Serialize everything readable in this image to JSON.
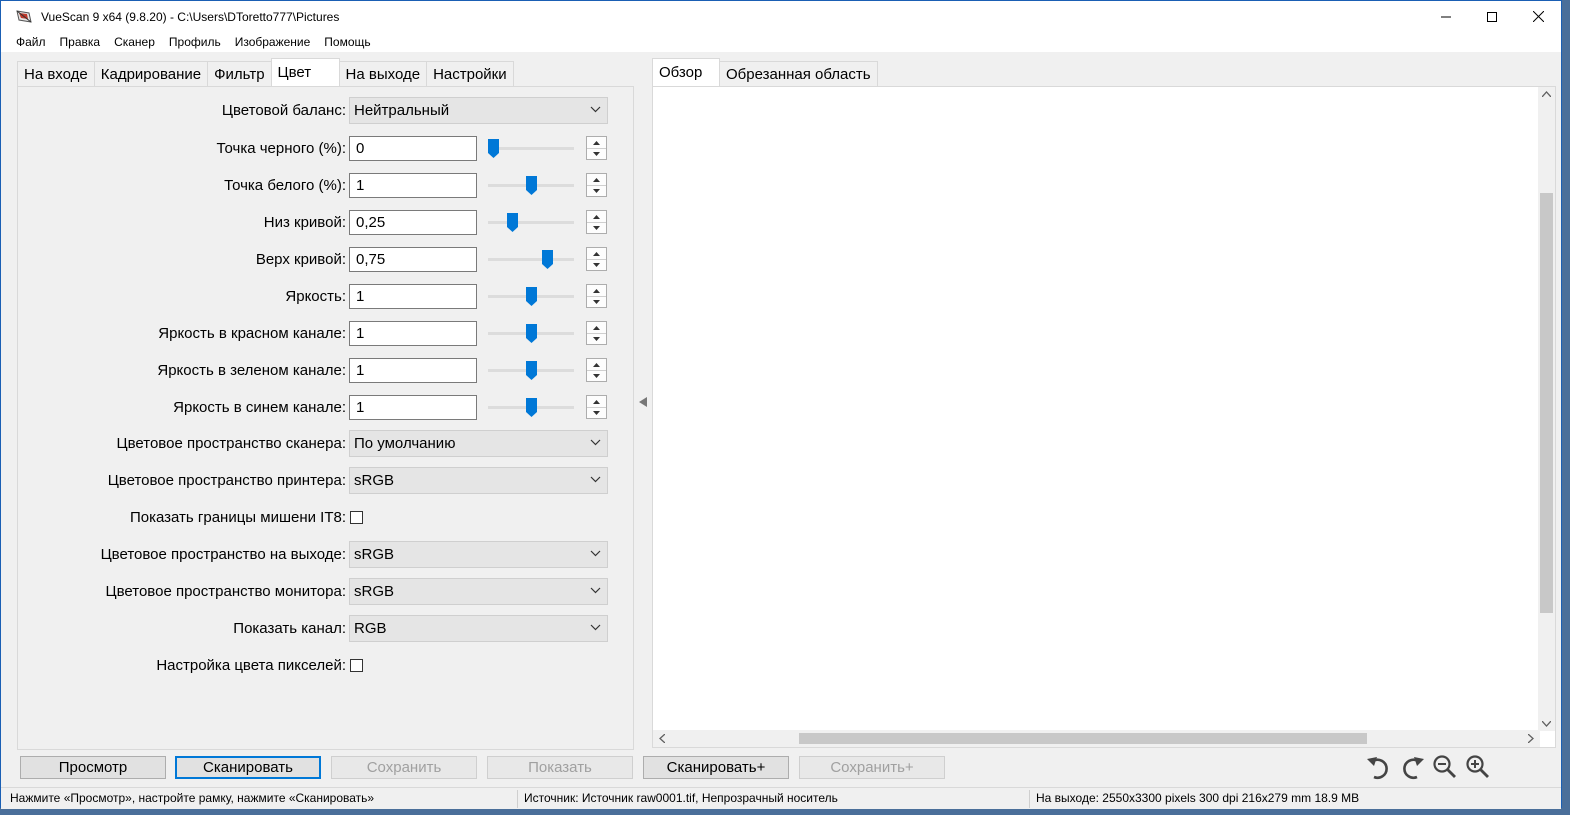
{
  "window": {
    "title": "VueScan 9 x64 (9.8.20) - C:\\Users\\DToretto777\\Pictures"
  },
  "menu": [
    "Файл",
    "Правка",
    "Сканер",
    "Профиль",
    "Изображение",
    "Помощь"
  ],
  "left_tabs": [
    {
      "label": "На входе",
      "active": false
    },
    {
      "label": "Кадрирование",
      "active": false
    },
    {
      "label": "Фильтр",
      "active": false
    },
    {
      "label": "Цвет",
      "active": true
    },
    {
      "label": "На выходе",
      "active": false
    },
    {
      "label": "Настройки",
      "active": false
    }
  ],
  "right_tabs": [
    {
      "label": "Обзор",
      "active": true
    },
    {
      "label": "Обрезанная область",
      "active": false
    }
  ],
  "settings": {
    "color_balance": {
      "label": "Цветовой баланс:",
      "value": "Нейтральный"
    },
    "black_point": {
      "label": "Точка черного (%):",
      "value": "0",
      "slider_level": 0.0
    },
    "white_point": {
      "label": "Точка белого (%):",
      "value": "1",
      "slider_level": 0.5
    },
    "curve_low": {
      "label": "Низ кривой:",
      "value": "0,25",
      "slider_level": 0.25
    },
    "curve_high": {
      "label": "Верх кривой:",
      "value": "0,75",
      "slider_level": 0.72
    },
    "brightness": {
      "label": "Яркость:",
      "value": "1",
      "slider_level": 0.5
    },
    "brightness_red": {
      "label": "Яркость в красном канале:",
      "value": "1",
      "slider_level": 0.5
    },
    "brightness_green": {
      "label": "Яркость в зеленом канале:",
      "value": "1",
      "slider_level": 0.5
    },
    "brightness_blue": {
      "label": "Яркость в синем канале:",
      "value": "1",
      "slider_level": 0.5
    },
    "scanner_color_space": {
      "label": "Цветовое пространство сканера:",
      "value": "По умолчанию"
    },
    "printer_color_space": {
      "label": "Цветовое пространство принтера:",
      "value": "sRGB"
    },
    "show_it8": {
      "label": "Показать границы мишени IT8:",
      "checked": false
    },
    "output_color_space": {
      "label": "Цветовое пространство на выходе:",
      "value": "sRGB"
    },
    "monitor_color_space": {
      "label": "Цветовое пространство монитора:",
      "value": "sRGB"
    },
    "show_channel": {
      "label": "Показать канал:",
      "value": "RGB"
    },
    "pixel_color": {
      "label": "Настройка цвета пикселей:",
      "checked": false
    }
  },
  "buttons": {
    "preview": "Просмотр",
    "scan": "Сканировать",
    "save": "Сохранить",
    "show": "Показать",
    "scan_plus": "Сканировать+",
    "save_plus": "Сохранить+"
  },
  "status": {
    "hint": "Нажмите «Просмотр», настройте рамку, нажмите «Сканировать»",
    "source": "Источник: Источник raw0001.tif, Непрозрачный носитель",
    "output": "На выходе: 2550x3300 pixels 300 dpi 216x279 mm 18.9 MB"
  },
  "colors": {
    "accent": "#0078d7",
    "window_border": "#1a5fb4",
    "slider_thumb": "#0078d7"
  }
}
